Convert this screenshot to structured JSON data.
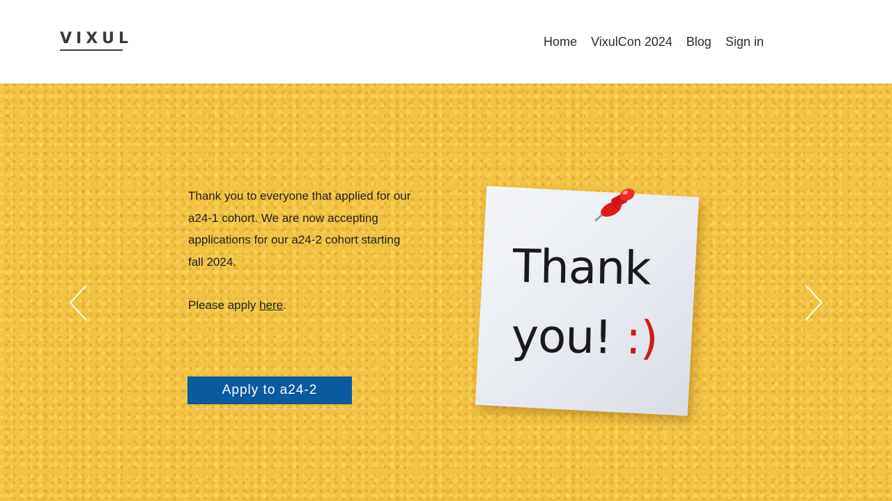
{
  "brand": {
    "logo_text": "VIXUL"
  },
  "nav": {
    "items": [
      {
        "label": "Home"
      },
      {
        "label": "VixulCon 2024"
      },
      {
        "label": "Blog"
      },
      {
        "label": "Sign in"
      }
    ]
  },
  "hero": {
    "paragraph1": "Thank you to everyone that applied for our a24-1 cohort. We are now accepting applications for our a24-2 cohort starting fall 2024.",
    "paragraph2_prefix": "Please apply ",
    "paragraph2_link": "here",
    "paragraph2_suffix": ".",
    "cta_label": "Apply to a24-2",
    "note_line1": "Thank",
    "note_line2": "you!",
    "note_smile": ":)"
  },
  "colors": {
    "hero_bg": "#f2c244",
    "cta_bg": "#0a5aa0",
    "logo": "#3a3a3a"
  },
  "icons": {
    "prev": "chevron-left-icon",
    "next": "chevron-right-icon",
    "pin": "pushpin-icon"
  }
}
